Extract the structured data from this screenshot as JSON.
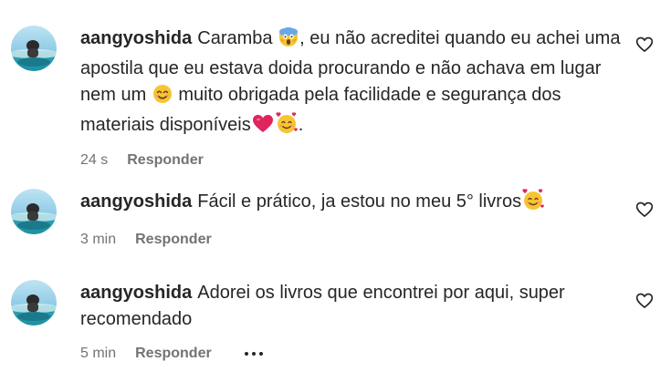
{
  "comments": [
    {
      "username": "aangyoshida",
      "segments": [
        "Caramba ",
        ", eu não acreditei quando eu achei uma apostila que eu estava doida procurando e não achava em lugar nem um ",
        " muito obrigada pela facilidade e segurança dos materiais disponíveis",
        "."
      ],
      "emojis": [
        "face-screaming-in-fear-icon",
        "smiling-face-icon",
        "red-heart-icon",
        "smiling-face-with-hearts-icon"
      ],
      "time": "24 s",
      "reply_label": "Responder"
    },
    {
      "username": "aangyoshida",
      "segments": [
        "Fácil e prático, ja estou no meu 5° livros"
      ],
      "emojis": [
        "smiling-face-with-hearts-icon"
      ],
      "time": "3 min",
      "reply_label": "Responder"
    },
    {
      "username": "aangyoshida",
      "segments": [
        "Adorei os livros que encontrei por aqui, super recomendado"
      ],
      "emojis": [],
      "time": "5 min",
      "reply_label": "Responder",
      "more_options_icon": "more-options-icon"
    }
  ],
  "colors": {
    "text": "#262626",
    "secondary_text": "#737373",
    "background": "#ffffff"
  }
}
